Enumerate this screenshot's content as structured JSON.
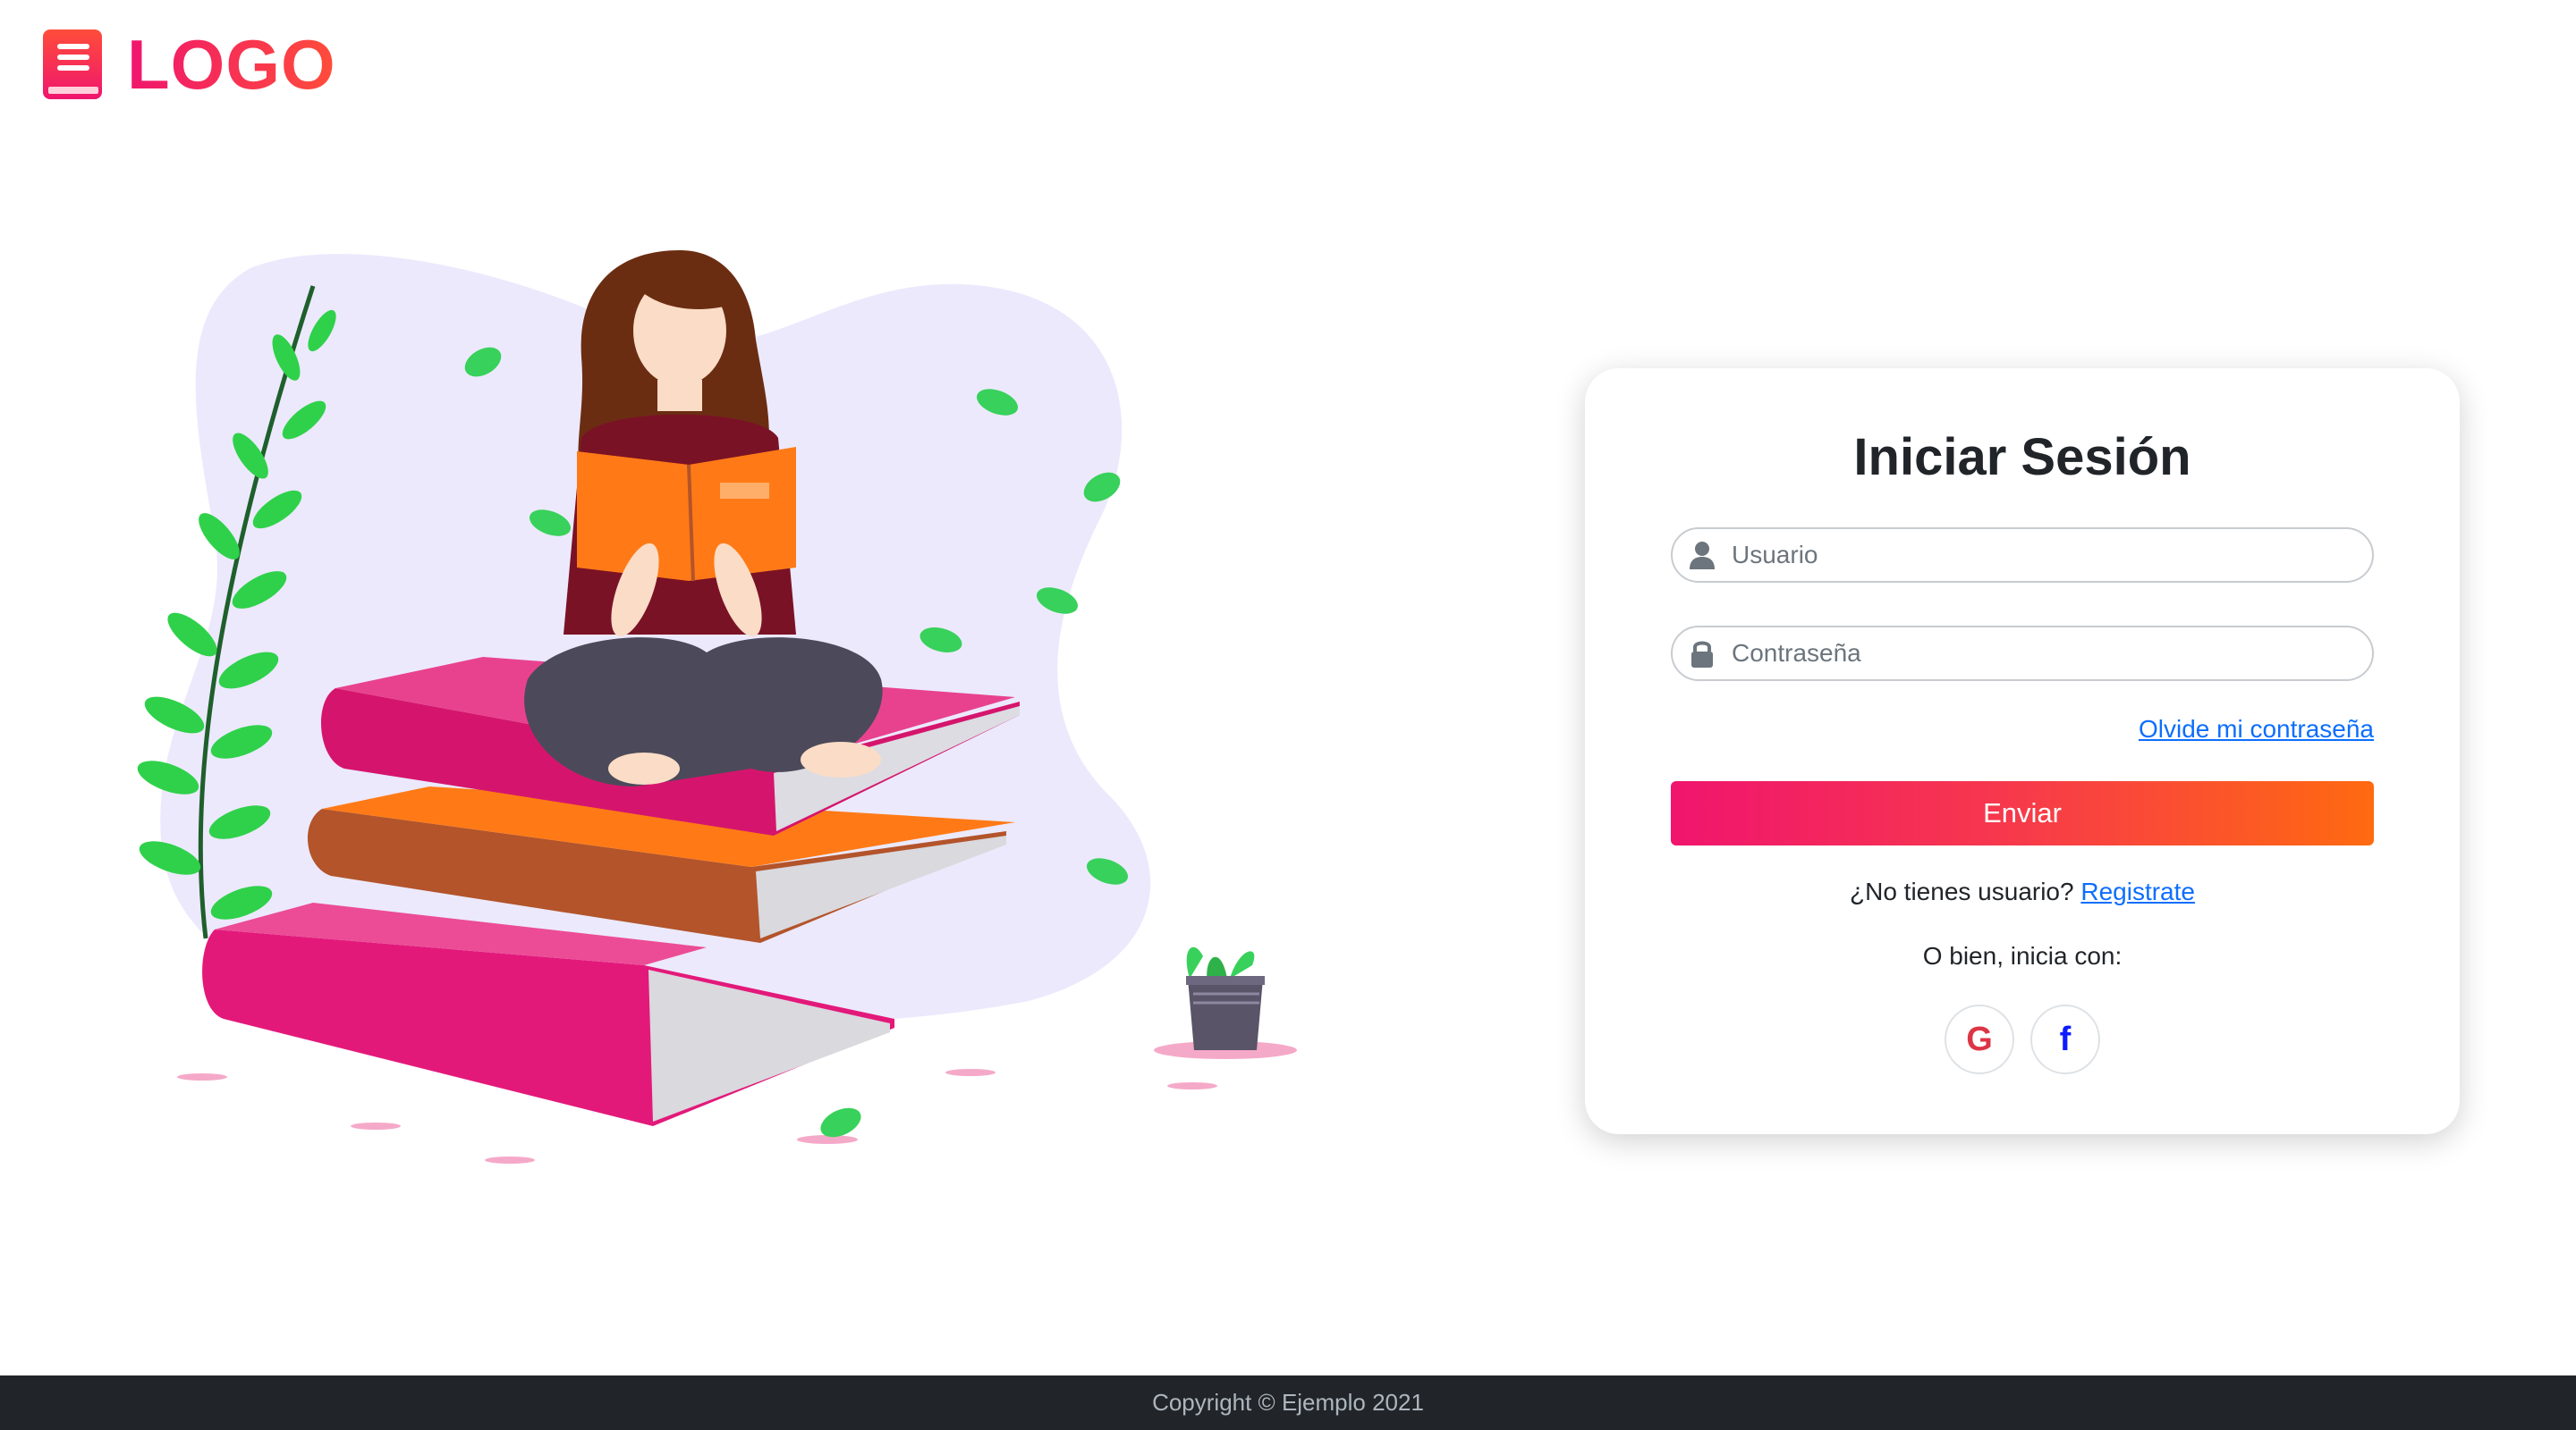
{
  "header": {
    "logo_text": "LOGO"
  },
  "login": {
    "title": "Iniciar Sesión",
    "username": {
      "placeholder": "Usuario",
      "value": ""
    },
    "password": {
      "placeholder": "Contraseña",
      "value": ""
    },
    "forgot_link": "Olvide mi contraseña",
    "submit_label": "Enviar",
    "register_prompt": "¿No tienes usuario?",
    "register_link": "Registrate",
    "alt_login_text": "O bien, inicia con:",
    "social": [
      {
        "name": "google",
        "glyph": "G",
        "color": "#dc3545",
        "icon": "google-icon"
      },
      {
        "name": "facebook",
        "glyph": "f",
        "color": "#0d1bff",
        "icon": "facebook-icon"
      }
    ]
  },
  "footer": {
    "copyright": "Copyright © Ejemplo 2021"
  },
  "colors": {
    "accent_start": "#f0156e",
    "accent_end": "#ff6a10",
    "link": "#0d6efd",
    "footer_bg": "#212529"
  }
}
